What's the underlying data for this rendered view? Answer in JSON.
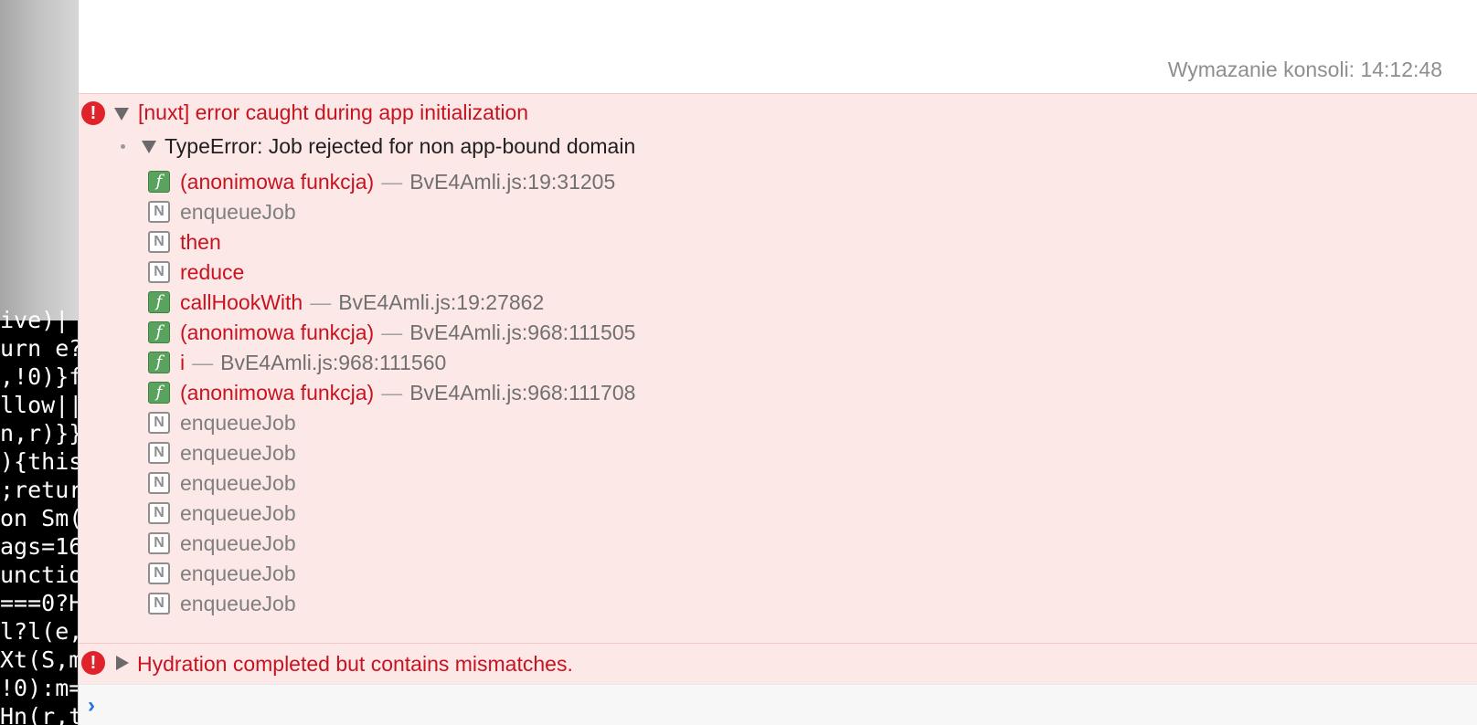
{
  "code_lines": [
    "ive)|",
    "urn e?",
    ",!0)}f",
    "llow||",
    "n,r)}}",
    "){this",
    ";retur",
    "on Sm(",
    "ags=16",
    "unctio",
    "===0?H",
    "l?l(e,",
    "Xt(S,m",
    "!0):m=",
    "Hn(r,t"
  ],
  "console": {
    "clear_message": "Wymazanie konsoli: 14:12:48",
    "error1": {
      "message": "[nuxt] error caught during app initialization",
      "sub_error": "TypeError: Job rejected for non app-bound domain",
      "stack": [
        {
          "badge": "f",
          "name": "(anonimowa funkcja)",
          "separator": "—",
          "location": "BvE4Amli.js:19:31205"
        },
        {
          "badge": "N",
          "name": "enqueueJob"
        },
        {
          "badge": "N",
          "name": "then"
        },
        {
          "badge": "N",
          "name": "reduce"
        },
        {
          "badge": "f",
          "name": "callHookWith",
          "separator": "—",
          "location": "BvE4Amli.js:19:27862"
        },
        {
          "badge": "f",
          "name": "(anonimowa funkcja)",
          "separator": "—",
          "location": "BvE4Amli.js:968:111505"
        },
        {
          "badge": "f",
          "name": "i",
          "separator": "—",
          "location": "BvE4Amli.js:968:111560"
        },
        {
          "badge": "f",
          "name": "(anonimowa funkcja)",
          "separator": "—",
          "location": "BvE4Amli.js:968:111708"
        },
        {
          "badge": "N",
          "name": "enqueueJob"
        },
        {
          "badge": "N",
          "name": "enqueueJob"
        },
        {
          "badge": "N",
          "name": "enqueueJob"
        },
        {
          "badge": "N",
          "name": "enqueueJob"
        },
        {
          "badge": "N",
          "name": "enqueueJob"
        },
        {
          "badge": "N",
          "name": "enqueueJob"
        },
        {
          "badge": "N",
          "name": "enqueueJob"
        }
      ]
    },
    "error2": {
      "message": "Hydration completed but contains mismatches."
    },
    "icons": {
      "error": "error-icon",
      "expanded": "disclosure-down-icon",
      "collapsed": "disclosure-right-icon",
      "prompt": "prompt-chevron-icon"
    },
    "colors": {
      "error_text": "#c8131f",
      "error_background": "#fde8e8",
      "native_text": "#7f7f7f",
      "function_badge": "#5aa35e",
      "prompt": "#1a73e8"
    }
  }
}
